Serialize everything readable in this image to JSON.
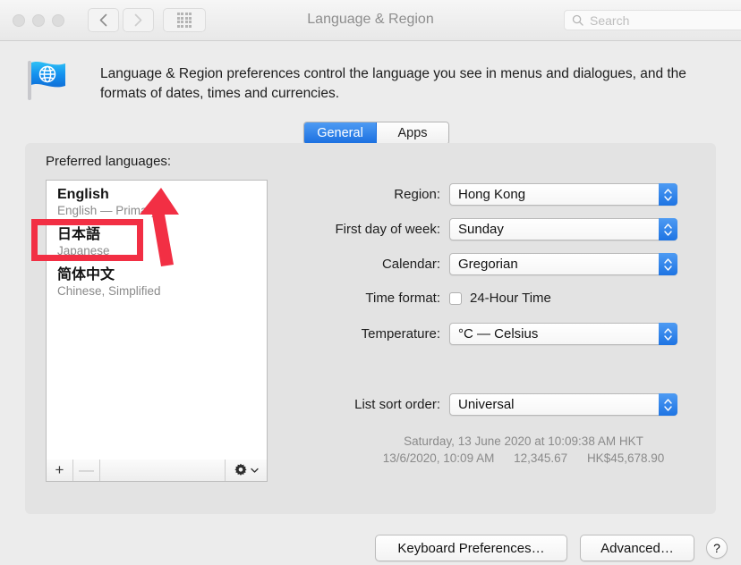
{
  "window": {
    "title": "Language & Region",
    "traffic_lights": [
      "close",
      "minimize",
      "zoom"
    ],
    "nav": {
      "back": "back-icon",
      "forward": "forward-icon",
      "grid": "show-all-icon"
    },
    "search": {
      "placeholder": "Search",
      "icon": "search-icon"
    }
  },
  "header": {
    "icon": "language-region-flag-icon",
    "description": "Language & Region preferences control the language you see in menus and dialogues, and the formats of dates, times and currencies."
  },
  "tabs": [
    {
      "label": "General",
      "active": true
    },
    {
      "label": "Apps",
      "active": false
    }
  ],
  "languages": {
    "label": "Preferred languages:",
    "items": [
      {
        "native": "English",
        "sub": "English — Primary"
      },
      {
        "native": "日本語",
        "sub": "Japanese"
      },
      {
        "native": "简体中文",
        "sub": "Chinese, Simplified"
      }
    ],
    "footer": {
      "add": "+",
      "remove": "—",
      "gear": "gear-icon"
    }
  },
  "settings": {
    "region": {
      "label": "Region:",
      "value": "Hong Kong"
    },
    "first_day": {
      "label": "First day of week:",
      "value": "Sunday"
    },
    "calendar": {
      "label": "Calendar:",
      "value": "Gregorian"
    },
    "time_format": {
      "label": "Time format:",
      "checkbox_label": "24-Hour Time",
      "checked": false
    },
    "temperature": {
      "label": "Temperature:",
      "value": "°C — Celsius"
    },
    "list_sort_order": {
      "label": "List sort order:",
      "value": "Universal"
    }
  },
  "sample": {
    "line1": "Saturday, 13 June 2020 at 10:09:38 AM HKT",
    "date": "13/6/2020, 10:09 AM",
    "number": "12,345.67",
    "currency": "HK$45,678.90"
  },
  "buttons": {
    "keyboard": "Keyboard Preferences…",
    "advanced": "Advanced…",
    "help": "?"
  },
  "annotations": {
    "color": "#f22f44",
    "highlight_box_target": "日本語 Japanese",
    "arrow_direction": "up"
  }
}
